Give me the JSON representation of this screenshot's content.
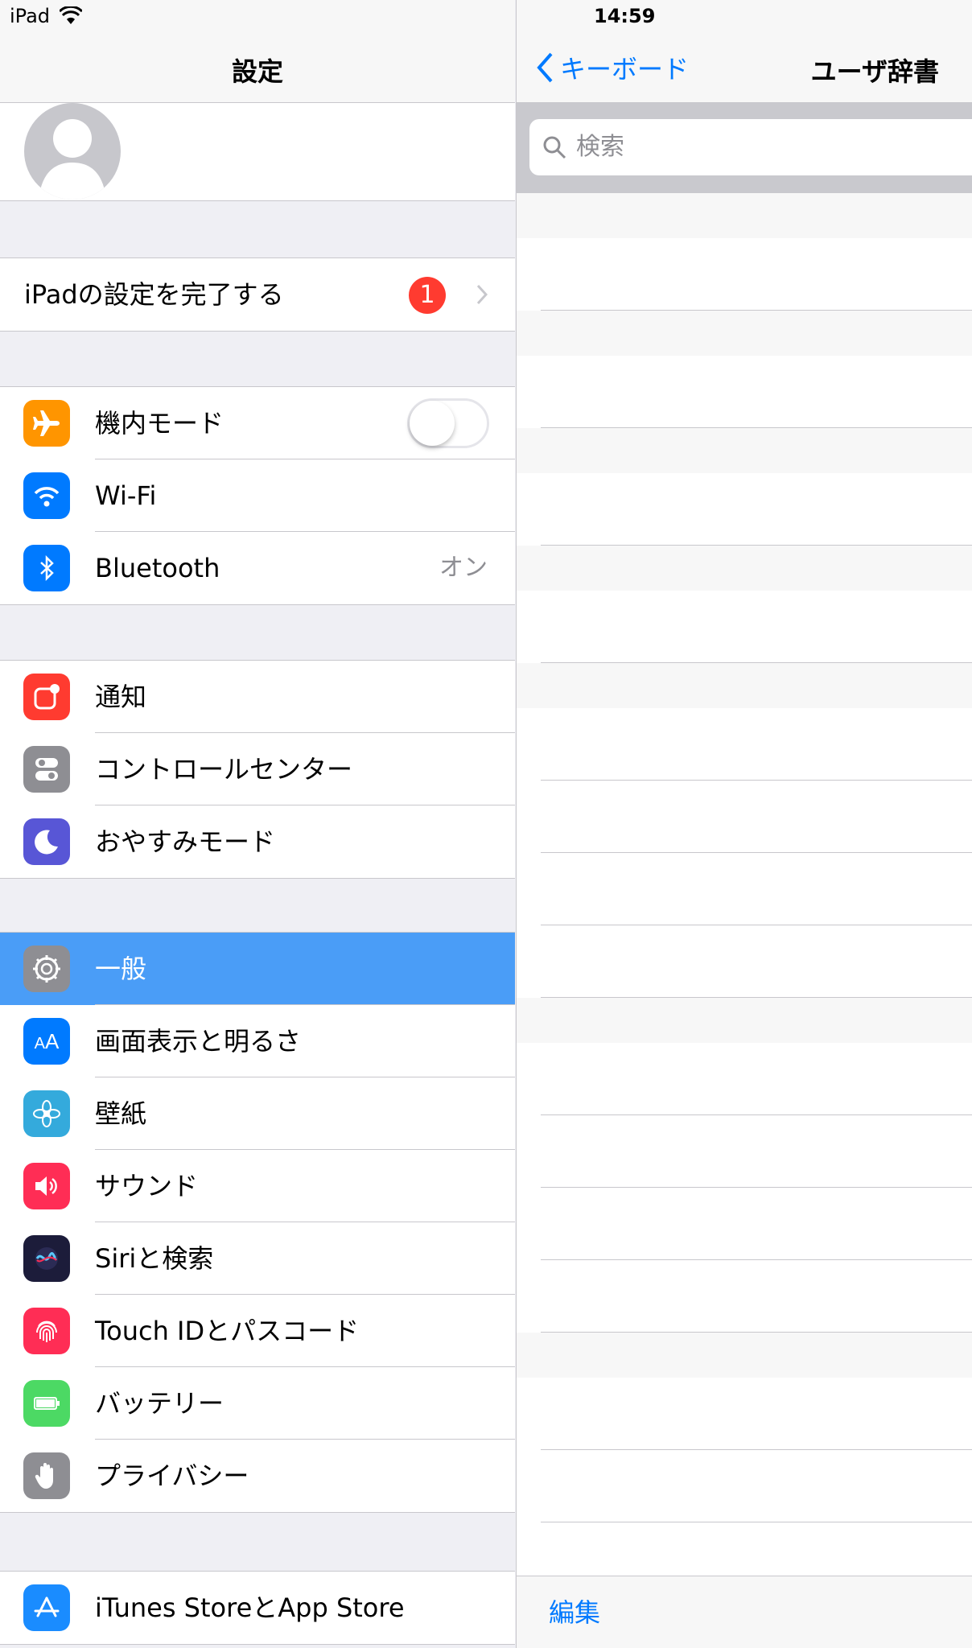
{
  "status_bar": {
    "device": "iPad",
    "time": "14:59"
  },
  "master": {
    "title": "設定",
    "setup_row": {
      "label": "iPadの設定を完了する",
      "badge": "1"
    },
    "group_connectivity": [
      {
        "label": "機内モード",
        "icon": "airplane-icon",
        "color": "#ff9500",
        "toggle": false
      },
      {
        "label": "Wi-Fi",
        "icon": "wifi-icon",
        "color": "#007aff"
      },
      {
        "label": "Bluetooth",
        "icon": "bluetooth-icon",
        "color": "#007aff",
        "value": "オン"
      }
    ],
    "group_notifications": [
      {
        "label": "通知",
        "icon": "notifications-icon",
        "color": "#ff3b30"
      },
      {
        "label": "コントロールセンター",
        "icon": "control-center-icon",
        "color": "#8e8e93"
      },
      {
        "label": "おやすみモード",
        "icon": "moon-icon",
        "color": "#5856d6"
      }
    ],
    "group_general": [
      {
        "label": "一般",
        "icon": "gear-icon",
        "color": "#8e8e93",
        "selected": true
      },
      {
        "label": "画面表示と明るさ",
        "icon": "display-icon",
        "color": "#007aff"
      },
      {
        "label": "壁紙",
        "icon": "wallpaper-icon",
        "color": "#34aadc"
      },
      {
        "label": "サウンド",
        "icon": "speaker-icon",
        "color": "#ff2d55"
      },
      {
        "label": "Siriと検索",
        "icon": "siri-icon",
        "color": "#1c1c3a"
      },
      {
        "label": "Touch IDとパスコード",
        "icon": "fingerprint-icon",
        "color": "#ff2d55"
      },
      {
        "label": "バッテリー",
        "icon": "battery-icon",
        "color": "#4cd964"
      },
      {
        "label": "プライバシー",
        "icon": "hand-icon",
        "color": "#8e8e93"
      }
    ],
    "group_store": [
      {
        "label": "iTunes StoreとApp Store",
        "icon": "app-store-icon",
        "color": "#1a8cff"
      }
    ]
  },
  "detail": {
    "back_label": "キーボード",
    "title": "ユーザ辞書",
    "search_placeholder": "検索",
    "edit_label": "編集"
  }
}
